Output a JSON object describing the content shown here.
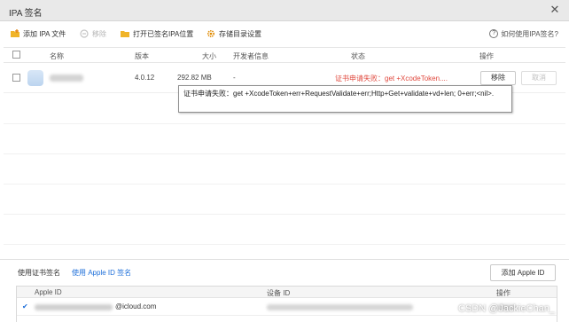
{
  "window": {
    "title": "IPA 签名",
    "close_symbol": "✕"
  },
  "toolbar": {
    "add_ipa": "添加 IPA 文件",
    "remove": "移除",
    "open_signed_location": "打开已签名IPA位置",
    "storage_settings": "存储目录设置",
    "help": "如何使用IPA签名?",
    "help_symbol": "?"
  },
  "table": {
    "columns": {
      "name": "名称",
      "version": "版本",
      "size": "大小",
      "developer": "开发者信息",
      "status": "状态",
      "operation": "操作"
    },
    "rows": [
      {
        "version": "4.0.12",
        "size": "292.82 MB",
        "developer": "-",
        "status": "证书申请失败：get +XcodeToken....",
        "remove_label": "移除",
        "cancel_label": "取消"
      }
    ]
  },
  "tooltip": {
    "text": "证书申请失败：get +XcodeToken+err+RequestValidate+err;Http+Get+validate+vd+len; 0+err;<nil>."
  },
  "bottom": {
    "tab_cert": "使用证书签名",
    "tab_appleid": "使用 Apple ID 签名",
    "add_appleid": "添加 Apple ID"
  },
  "appleid_table": {
    "columns": {
      "apple_id": "Apple ID",
      "device_id": "设备 ID",
      "operation": "操作"
    },
    "rows": [
      {
        "check": "✔",
        "email_suffix": "@icloud.com"
      }
    ]
  },
  "watermark": "CSDN @JackieChan_",
  "colors": {
    "error": "#e04a3f",
    "link": "#1e6fd9",
    "folder": "#f0b429"
  }
}
